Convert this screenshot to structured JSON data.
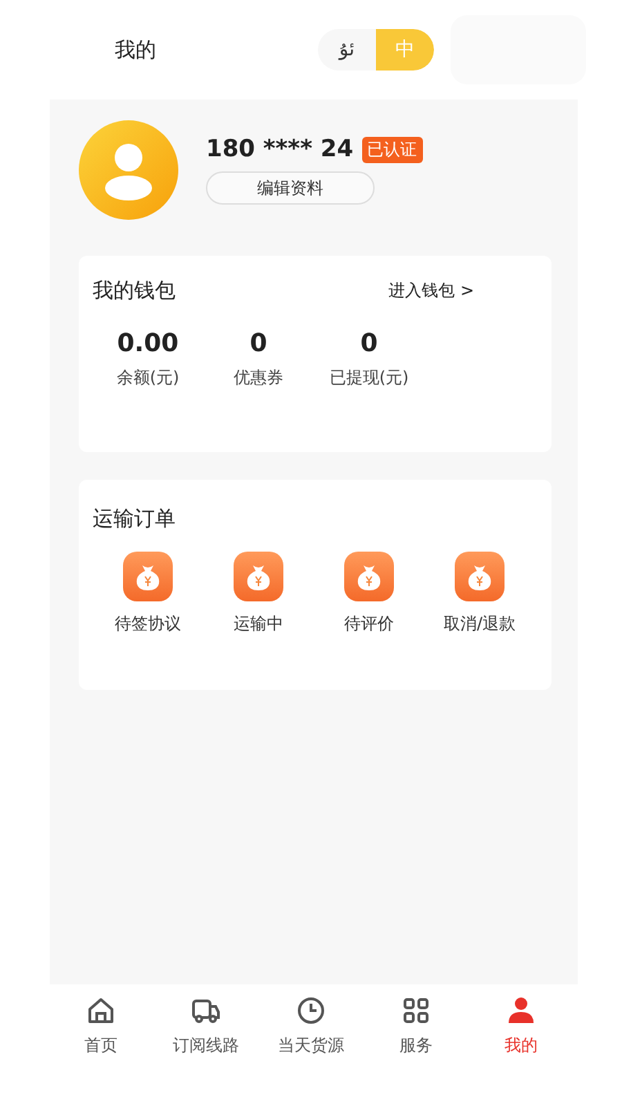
{
  "header": {
    "title": "我的",
    "languages": [
      {
        "label": "ئۇ",
        "selected": false
      },
      {
        "label": "中",
        "selected": true
      }
    ]
  },
  "profile": {
    "phone": "180 **** 24",
    "badge": "已认证",
    "edit_button": "编辑资料"
  },
  "wallet": {
    "title": "我的钱包",
    "link": "进入钱包 >",
    "stats": [
      {
        "value": "0.00",
        "label": "余额(元)"
      },
      {
        "value": "0",
        "label": "优惠券"
      },
      {
        "value": "0",
        "label": "已提现(元)"
      }
    ]
  },
  "orders": {
    "title": "运输订单",
    "items": [
      {
        "label": "待签协议"
      },
      {
        "label": "运输中"
      },
      {
        "label": "待评价"
      },
      {
        "label": "取消/退款"
      }
    ]
  },
  "tab_bar": [
    {
      "label": "首页",
      "kind": "home",
      "selected": false
    },
    {
      "label": "订阅线路",
      "kind": "truck",
      "selected": false
    },
    {
      "label": "当天货源",
      "kind": "clock",
      "selected": false
    },
    {
      "label": "服务",
      "kind": "grid",
      "selected": false
    },
    {
      "label": "我的",
      "kind": "person",
      "selected": true
    }
  ]
}
